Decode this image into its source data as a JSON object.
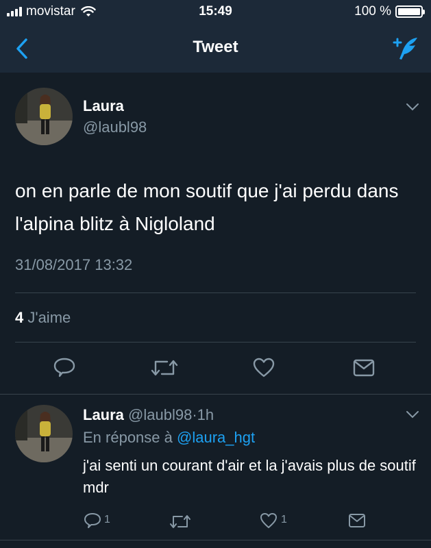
{
  "status_bar": {
    "carrier": "movistar",
    "time": "15:49",
    "battery_text": "100 %",
    "battery_level": 1.0
  },
  "navbar": {
    "title": "Tweet",
    "back_icon": "chevron-left-icon",
    "compose_icon": "compose-tweet-icon"
  },
  "tweet": {
    "name": "Laura",
    "handle": "@laubl98",
    "text": "on en parle de mon soutif que j'ai perdu dans l'alpina blitz à Nigloland",
    "date": "31/08/2017 13:32",
    "likes_count": "4",
    "likes_label": "J'aime",
    "actions": [
      "reply-icon",
      "retweet-icon",
      "like-icon",
      "share-icon"
    ]
  },
  "reply": {
    "name": "Laura",
    "handle": "@laubl98",
    "time_separator": "·",
    "time": "1h",
    "in_reply_to_label": "En réponse à",
    "in_reply_to": "@laura_hgt",
    "text": "j'ai senti un courant d'air et la j'avais plus de soutif mdr",
    "reply_count": "1",
    "like_count": "1"
  },
  "colors": {
    "background": "#141d26",
    "bar": "#1c2938",
    "accent": "#1da1f2",
    "secondary_text": "#8899a6",
    "divider": "#38444d"
  }
}
